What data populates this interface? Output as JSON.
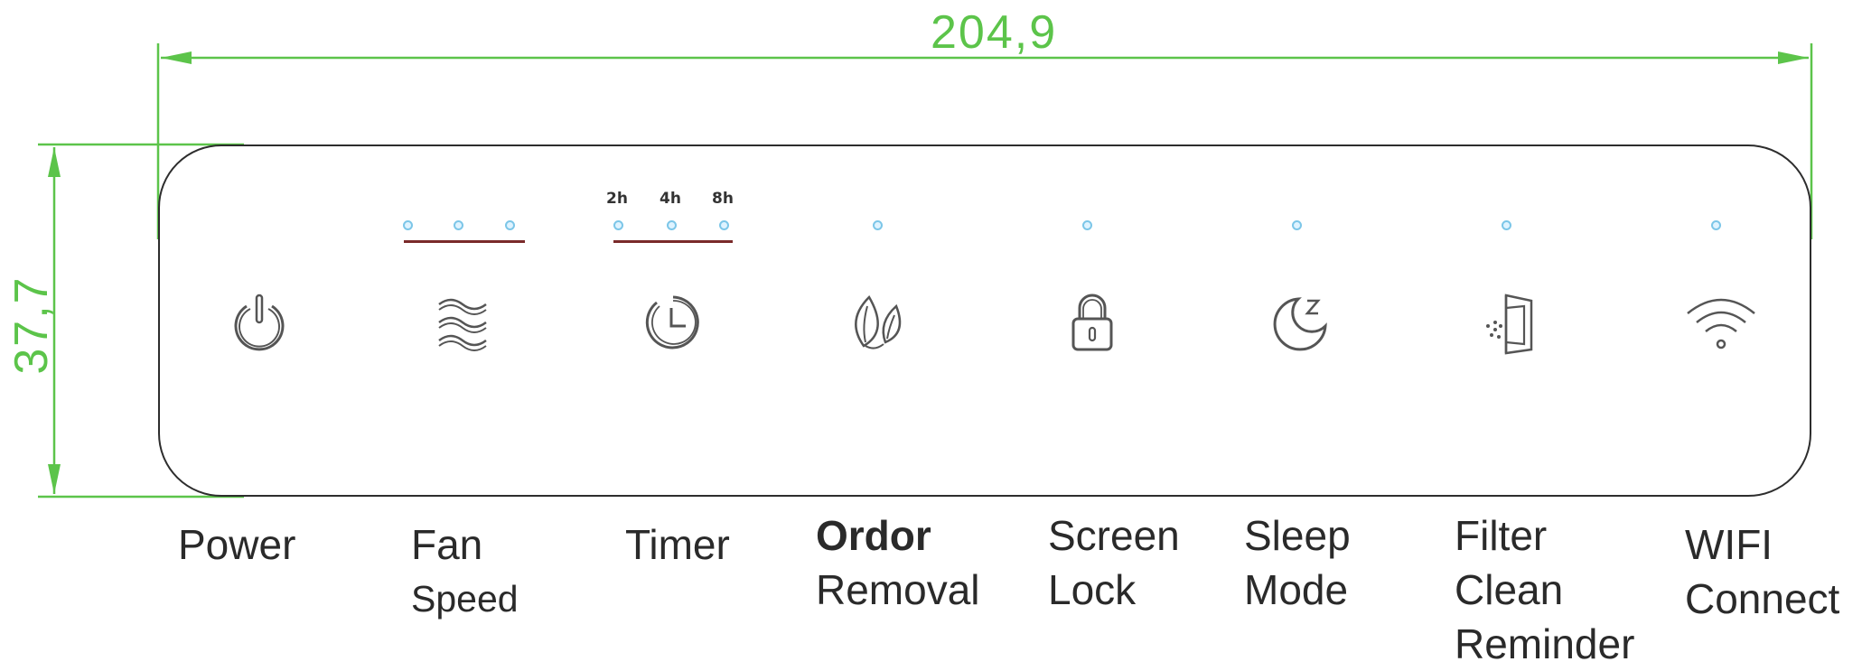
{
  "dimensions": {
    "width_label": "204,9",
    "height_label": "37,7",
    "line_color": "#5cc44a"
  },
  "panel": {
    "border_color": "#2d2d2d",
    "led_color": "#7cc6e8",
    "led_bar_color": "#7a2a2a",
    "timer_labels": [
      "2h",
      "4h",
      "8h"
    ]
  },
  "buttons": [
    {
      "key": "power",
      "icon": "power-icon",
      "label_lines": [
        "Power"
      ]
    },
    {
      "key": "fan-speed",
      "icon": "fan-wave-icon",
      "label_lines": [
        "Fan",
        "Speed"
      ]
    },
    {
      "key": "timer",
      "icon": "clock-icon",
      "label_lines": [
        "Timer"
      ]
    },
    {
      "key": "odor-removal",
      "icon": "leaf-icon",
      "label_lines": [
        "Ordor",
        "Removal"
      ]
    },
    {
      "key": "screen-lock",
      "icon": "lock-icon",
      "label_lines": [
        "Screen",
        "Lock"
      ]
    },
    {
      "key": "sleep-mode",
      "icon": "moon-icon",
      "label_lines": [
        "Sleep",
        "Mode"
      ]
    },
    {
      "key": "filter-clean",
      "icon": "filter-door-icon",
      "label_lines": [
        "Filter",
        "Clean",
        "Reminder"
      ]
    },
    {
      "key": "wifi-connect",
      "icon": "wifi-icon",
      "label_lines": [
        "WIFI",
        "Connect"
      ]
    }
  ]
}
